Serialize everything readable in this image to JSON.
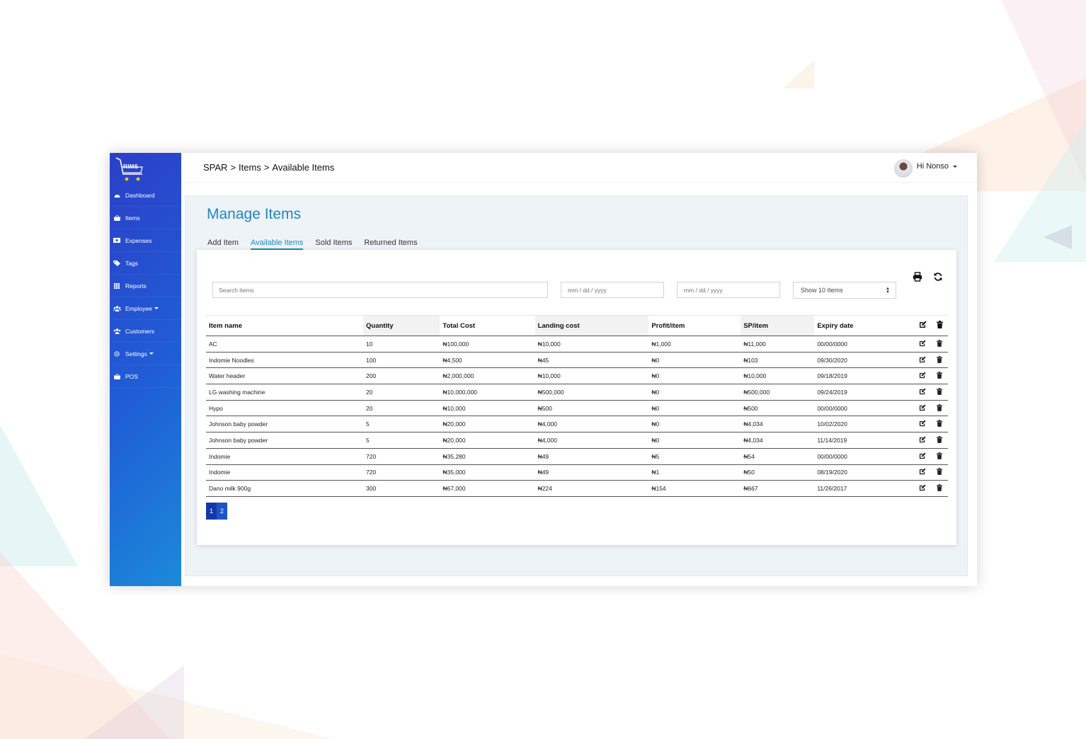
{
  "app": {
    "logo_text": "RIMS"
  },
  "sidebar": {
    "items": [
      {
        "label": "Dashboard",
        "icon": "dashboard-icon"
      },
      {
        "label": "Items",
        "icon": "basket-icon"
      },
      {
        "label": "Expenses",
        "icon": "money-icon"
      },
      {
        "label": "Tags",
        "icon": "tags-icon"
      },
      {
        "label": "Reports",
        "icon": "grid-icon"
      },
      {
        "label": "Employee",
        "icon": "users-icon"
      },
      {
        "label": "Customers",
        "icon": "users-icon"
      },
      {
        "label": "Settings",
        "icon": "gear-icon"
      },
      {
        "label": "POS",
        "icon": "basket-icon"
      }
    ]
  },
  "header": {
    "breadcrumb": [
      "SPAR",
      ">",
      "Items",
      ">",
      "Available Items"
    ],
    "user_greeting": "Hi Nonso"
  },
  "page": {
    "title": "Manage Items",
    "tabs": [
      {
        "label": "Add Item",
        "active": false
      },
      {
        "label": "Available Items",
        "active": true
      },
      {
        "label": "Sold Items",
        "active": false
      },
      {
        "label": "Returned Items",
        "active": false
      }
    ]
  },
  "filters": {
    "search_placeholder": "Search items",
    "date_from": "mm / dd / yyyy",
    "date_to": "mm / dd / yyyy",
    "page_size": "Show 10 Items"
  },
  "table": {
    "columns": [
      "Item name",
      "Quantity",
      "Total Cost",
      "Landing cost",
      "Profit/item",
      "SP/item",
      "Expiry date"
    ],
    "rows": [
      [
        "AC",
        "10",
        "₦100,000",
        "₦10,000",
        "₦1,000",
        "₦11,000",
        "00/00/0000"
      ],
      [
        "Indomie Noodles",
        "100",
        "₦4,500",
        "₦45",
        "₦0",
        "₦103",
        "09/30/2020"
      ],
      [
        "Water header",
        "200",
        "₦2,000,000",
        "₦10,000",
        "₦0",
        "₦10,000",
        "09/18/2019"
      ],
      [
        "LG washing machine",
        "20",
        "₦10,000,000",
        "₦500,000",
        "₦0",
        "₦500,000",
        "09/24/2019"
      ],
      [
        "Hypo",
        "20",
        "₦10,000",
        "₦500",
        "₦0",
        "₦500",
        "00/00/0000"
      ],
      [
        "Johnson baby powder",
        "5",
        "₦20,000",
        "₦4,000",
        "₦0",
        "₦4,034",
        "10/02/2020"
      ],
      [
        "Johnson baby powder",
        "5",
        "₦20,000",
        "₦4,000",
        "₦0",
        "₦4,034",
        "11/14/2019"
      ],
      [
        "Indomie",
        "720",
        "₦35,280",
        "₦49",
        "₦5",
        "₦54",
        "00/00/0000"
      ],
      [
        "Indomie",
        "720",
        "₦35,000",
        "₦49",
        "₦1",
        "₦50",
        "08/19/2020"
      ],
      [
        "Dano milk 900g",
        "300",
        "₦67,000",
        "₦224",
        "₦154",
        "₦667",
        "11/26/2017"
      ]
    ]
  },
  "pagination": {
    "pages": [
      "1",
      "2"
    ],
    "current": "1"
  },
  "colors": {
    "accent": "#1f86c3",
    "sidebar_start": "#2b3fc9",
    "sidebar_end": "#1c8ad8",
    "pager": "#1b55c8"
  }
}
